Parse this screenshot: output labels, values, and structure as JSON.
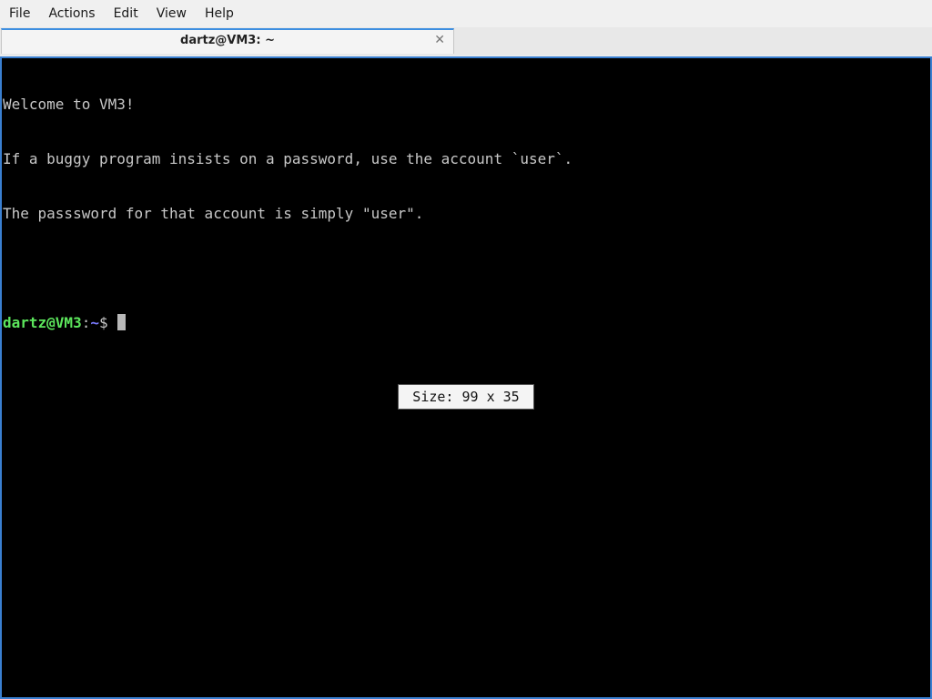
{
  "menubar": {
    "items": [
      "File",
      "Actions",
      "Edit",
      "View",
      "Help"
    ]
  },
  "tab": {
    "title": "dartz@VM3: ~",
    "close_glyph": "✕"
  },
  "terminal": {
    "lines": [
      "Welcome to VM3!",
      "If a buggy program insists on a password, use the account `user`.",
      "The passsword for that account is simply \"user\".",
      ""
    ],
    "prompt": {
      "user_host": "dartz@VM3",
      "separator": ":",
      "path": "~",
      "symbol": "$"
    },
    "colors": {
      "background": "#000000",
      "text": "#c8c8c8",
      "prompt_user": "#5ce65c",
      "prompt_path": "#7b7bff",
      "border_accent": "#3a7fd0"
    }
  },
  "size_tooltip": {
    "text": "Size: 99 x 35"
  }
}
